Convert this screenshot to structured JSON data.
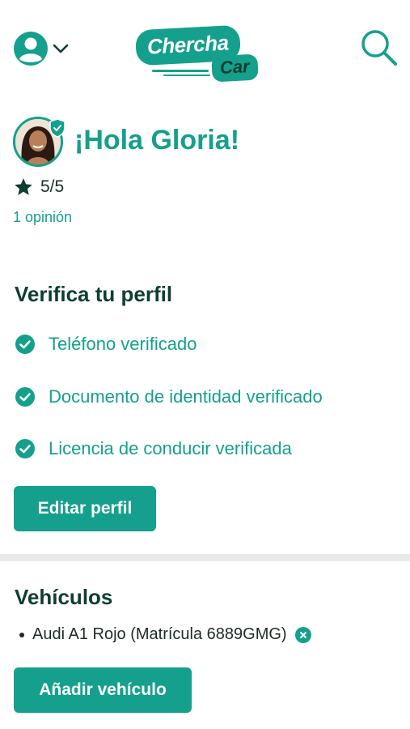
{
  "header": {
    "logo_top": "Chercha",
    "logo_bottom": "Car",
    "account_icon": "user-circle-icon",
    "search_icon": "search-icon"
  },
  "profile": {
    "greeting": "¡Hola Gloria!",
    "rating": "5/5",
    "reviews": "1 opinión"
  },
  "verify": {
    "title": "Verifica tu perfil",
    "items": [
      {
        "label": "Teléfono verificado"
      },
      {
        "label": "Documento de identidad verificado"
      },
      {
        "label": "Licencia de conducir verificada"
      }
    ],
    "edit_button": "Editar perfil"
  },
  "vehicles": {
    "title": "Vehículos",
    "items": [
      {
        "label": "Audi A1 Rojo (Matrícula 6889GMG)"
      }
    ],
    "add_button": "Añadir vehículo"
  },
  "colors": {
    "brand": "#14a08c",
    "dark": "#0f3d32"
  }
}
